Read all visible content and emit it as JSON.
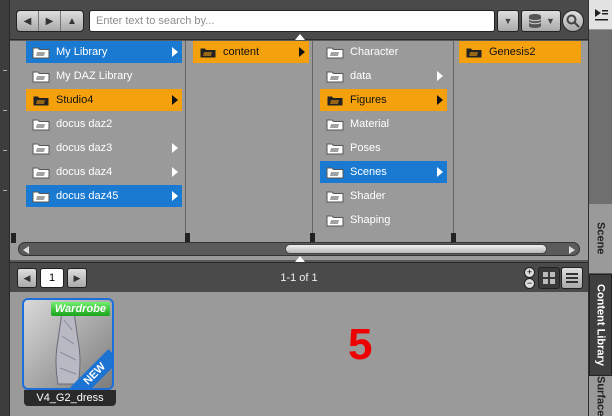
{
  "toolbar": {
    "search_placeholder": "Enter text to search by..."
  },
  "columns": [
    {
      "items": [
        {
          "label": "My Library",
          "state": "blue",
          "has_children": true
        },
        {
          "label": "My DAZ Library",
          "state": "none",
          "has_children": false
        },
        {
          "label": "Studio4",
          "state": "orange",
          "has_children": true
        },
        {
          "label": "docus daz2",
          "state": "none",
          "has_children": false
        },
        {
          "label": "docus daz3",
          "state": "none",
          "has_children": true
        },
        {
          "label": "docus daz4",
          "state": "none",
          "has_children": true
        },
        {
          "label": "docus daz45",
          "state": "blue",
          "has_children": true
        }
      ]
    },
    {
      "items": [
        {
          "label": "content",
          "state": "orange",
          "has_children": true
        }
      ]
    },
    {
      "items": [
        {
          "label": "Character",
          "state": "none",
          "has_children": false
        },
        {
          "label": "data",
          "state": "none",
          "has_children": true
        },
        {
          "label": "Figures",
          "state": "orange",
          "has_children": true
        },
        {
          "label": "Material",
          "state": "none",
          "has_children": false
        },
        {
          "label": "Poses",
          "state": "none",
          "has_children": false
        },
        {
          "label": "Scenes",
          "state": "blue",
          "has_children": true
        },
        {
          "label": "Shader",
          "state": "none",
          "has_children": false
        },
        {
          "label": "Shaping",
          "state": "none",
          "has_children": false
        }
      ]
    },
    {
      "items": [
        {
          "label": "Genesis2",
          "state": "orange",
          "has_children": false
        }
      ]
    }
  ],
  "pager": {
    "page": "1",
    "count_text": "1-1 of 1"
  },
  "results": {
    "item_label": "V4_G2_dress",
    "wardrobe_badge": "Wardrobe",
    "new_badge": "NEW",
    "annotation": "5"
  },
  "side_tabs": {
    "scene": "Scene",
    "content_library": "Content Library",
    "surfaces": "Surfaces"
  },
  "colors": {
    "selected_blue": "#1a7ad2",
    "path_orange": "#f5a10d",
    "annotation_red": "#e00000"
  }
}
